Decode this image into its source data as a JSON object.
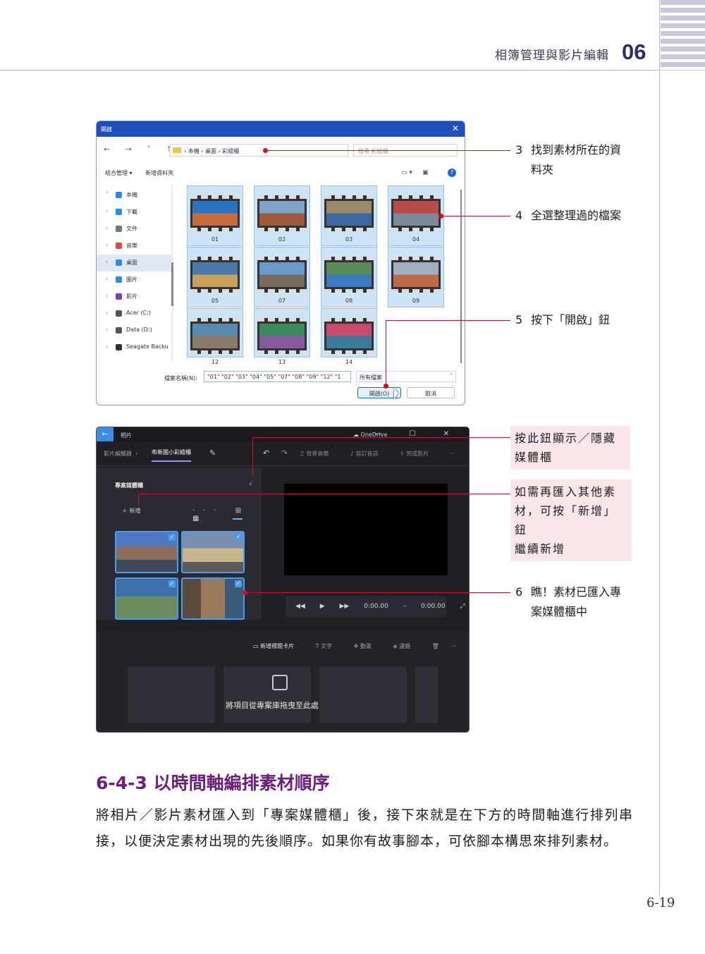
{
  "header": {
    "title": "相簿管理與影片編輯",
    "chapter": "06",
    "page_number": "6-19"
  },
  "open_dialog": {
    "title": "開啟",
    "close": "✕",
    "nav_arrows": "← → ˅ ↑",
    "address_path": "› 本機 › 桌面 › 彩繪櫃",
    "search_placeholder": "搜尋 彩繪櫃",
    "toolbar": [
      "組合管理 ▾",
      "新增資料夾"
    ],
    "help": "?",
    "tree": [
      {
        "label": "本機",
        "arrow": "˅",
        "color": "#2d8ae0"
      },
      {
        "label": "下載",
        "arrow": "›",
        "color": "#1f8fe0"
      },
      {
        "label": "文件",
        "arrow": "›",
        "color": "#6b7a8c"
      },
      {
        "label": "音樂",
        "arrow": "›",
        "color": "#e0493c"
      },
      {
        "label": "桌面",
        "arrow": "›",
        "color": "#2d8ae0"
      },
      {
        "label": "圖片",
        "arrow": "›",
        "color": "#2d8ae0"
      },
      {
        "label": "影片",
        "arrow": "›",
        "color": "#7b3fc2"
      },
      {
        "label": "Acer (C:)",
        "arrow": "›",
        "color": "#555555"
      },
      {
        "label": "Data (D:)",
        "arrow": "›",
        "color": "#555555"
      },
      {
        "label": "Seagate Backu",
        "arrow": "›",
        "color": "#333333"
      }
    ],
    "files": [
      "01",
      "02",
      "03",
      "04",
      "05",
      "07",
      "08",
      "09",
      "12",
      "13",
      "14"
    ],
    "filename_label": "檔案名稱(N):",
    "filename_value": "\"01\" \"02\" \"03\" \"04\" \"05\" \"07\" \"08\" \"09\" \"12\" \"1",
    "filter": "所有檔案",
    "open_button": "開啟(O)",
    "cancel_button": "取消"
  },
  "video_editor": {
    "app_name": "相片",
    "cloud": "OneDrive",
    "window_controls": "— ☐ ✕",
    "tab_editor": "影片編輯器",
    "tab_project": "布新園小彩繪櫃",
    "toolbar": [
      "背景音樂",
      "自訂音訊",
      "完成影片",
      "···"
    ],
    "panel_title": "專案媒體櫃",
    "new_button": "＋ 新增",
    "panel_options": "···",
    "transport": {
      "time_current": "0:00.00",
      "time_total": "0:00.00"
    },
    "timeline_tools": [
      "新增標題卡片",
      "文字",
      "動畫",
      "濾鏡",
      "···"
    ],
    "drop_hint": "將項目從專案庫拖曳至此處"
  },
  "callouts": {
    "c3_num": "3",
    "c3_text_1": "找到素材所在的資",
    "c3_text_2": "料夾",
    "c4_num": "4",
    "c4_text": "全選整理過的檔案",
    "c5_num": "5",
    "c5_text": "按下「開啟」鈕",
    "toggle_1": "按此鈕顯示／隱藏",
    "toggle_2": "媒體櫃",
    "import_1": "如需再匯入其他素",
    "import_2": "材，可按「新增」鈕",
    "import_3": "繼續新增",
    "c6_num": "6",
    "c6_text_1": "瞧！素材已匯入專",
    "c6_text_2": "案媒體櫃中"
  },
  "section": {
    "title": "6-4-3  以時間軸編排素材順序",
    "body": "將相片／影片素材匯入到「專案媒體櫃」後，接下來就是在下方的時間軸進行排列串接，以便決定素材出現的先後順序。如果你有故事腳本，可依腳本構思來排列素材。"
  },
  "colors": {
    "callout_red": "#cc1126",
    "section_title": "#6b1e7a",
    "dialog_titlebar": "#1f4fbb",
    "selection_blue": "#cde3f8",
    "callout_box_pink": "#fbe6ec"
  }
}
